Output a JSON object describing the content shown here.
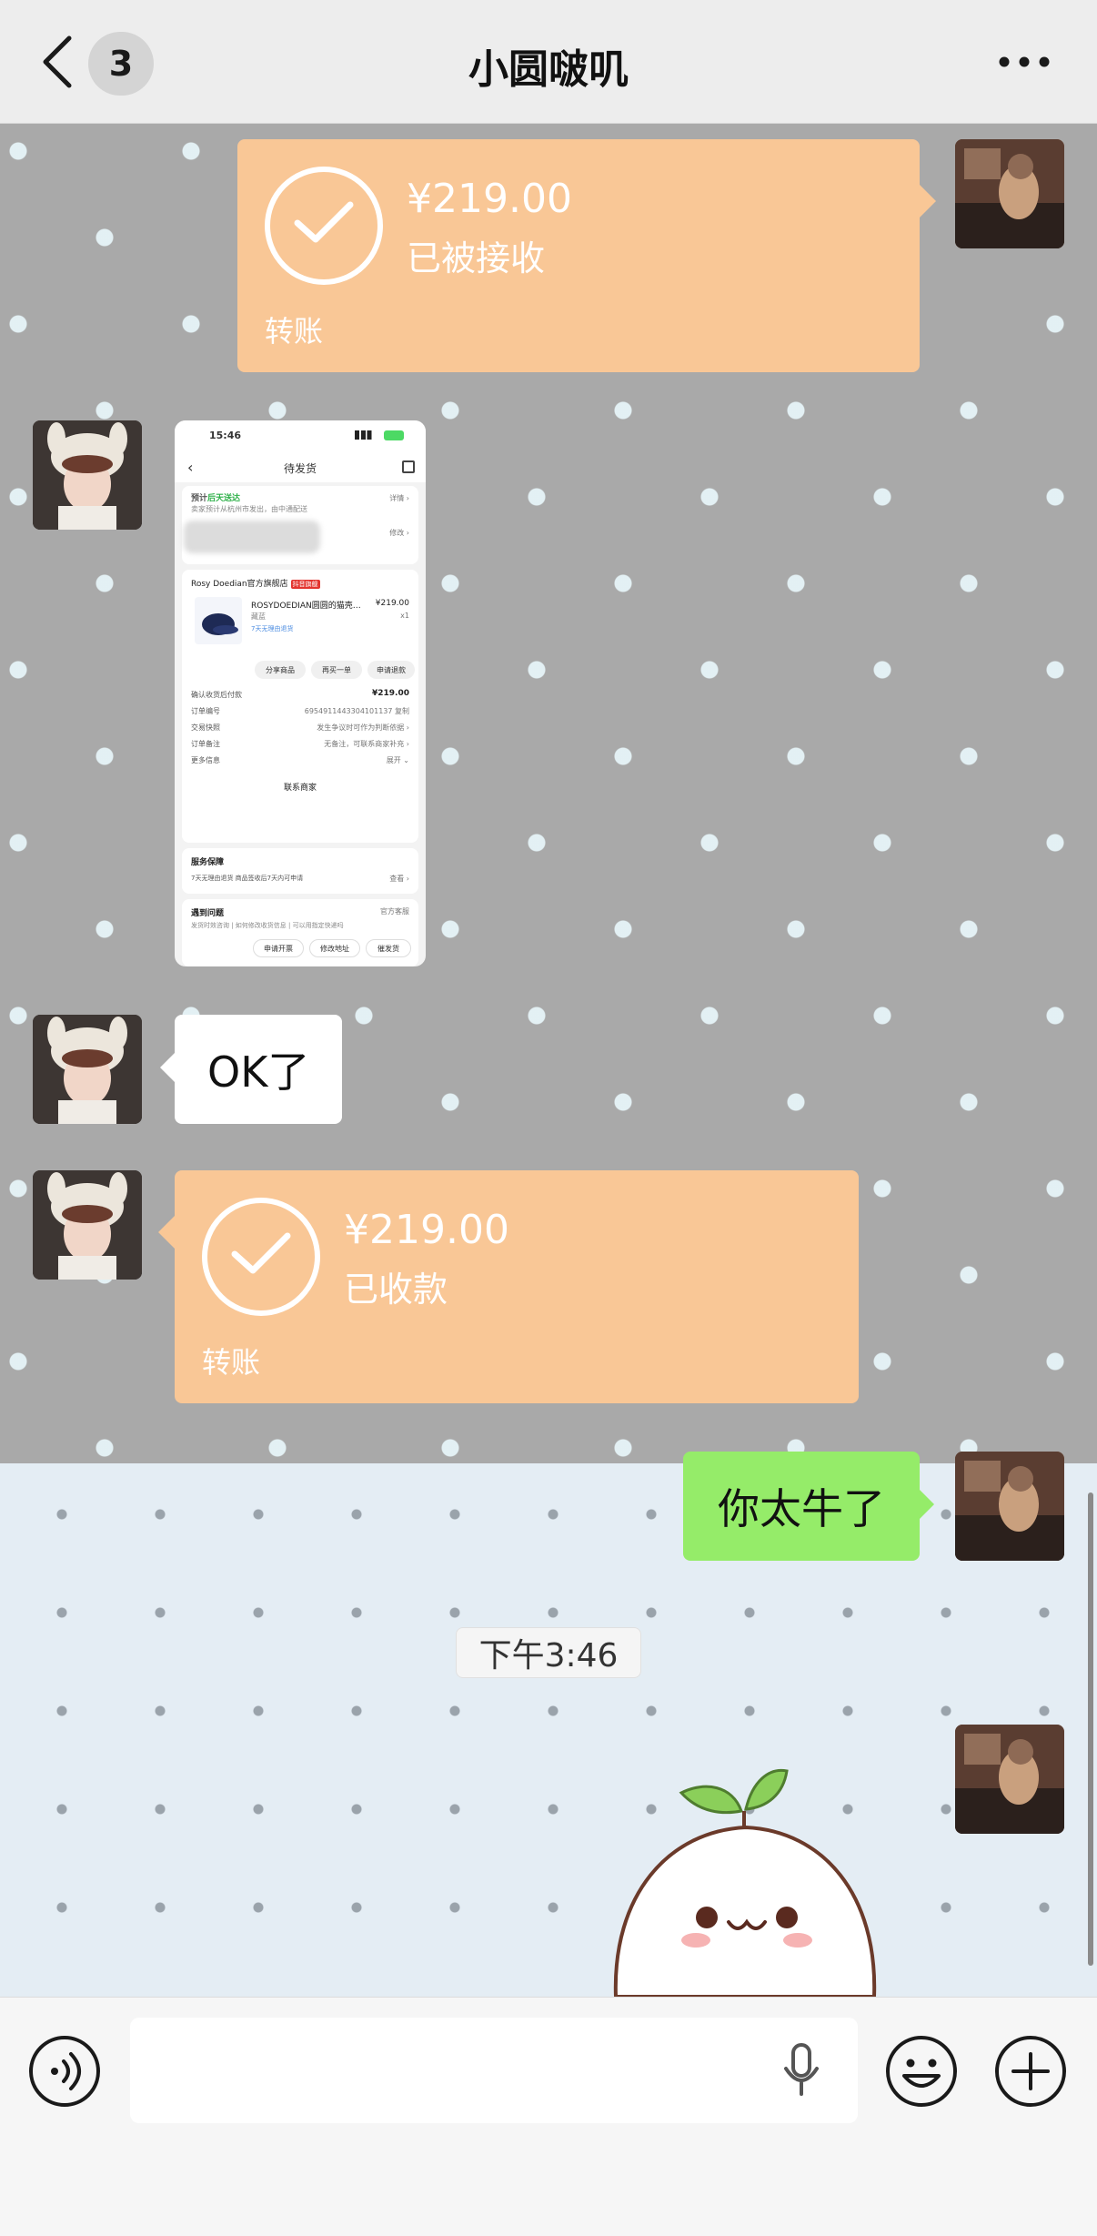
{
  "header": {
    "back_icon": "chevron-left-icon",
    "unread_count": "3",
    "title": "小圆啵叽",
    "more_icon": "more-dots-icon"
  },
  "messages": {
    "transfer_sent": {
      "amount": "¥219.00",
      "status": "已被接收",
      "label": "转账"
    },
    "screenshot": {
      "time": "15:46",
      "nav_title": "待发货",
      "eta_prefix": "预计",
      "eta_highlight": "后天送达",
      "eta_sub": "卖家预计从杭州市发出，由中通配送",
      "detail_link": "详情 ›",
      "modify_link": "修改 ›",
      "shop_name": "Rosy Doedian官方旗舰店",
      "shop_tag": "抖音旗舰",
      "product_name": "ROSYDOEDIAN圆圆的猫壳…",
      "product_color": "藏蓝",
      "product_service": "7天无理由退货",
      "product_price": "¥219.00",
      "product_qty": "x1",
      "btn_share": "分享商品",
      "btn_rebuy": "再买一单",
      "btn_refund": "申请退款",
      "paid_label": "确认收货后付款",
      "paid_value": "¥219.00",
      "order_label": "订单编号",
      "order_value": "6954911443304101137  复制",
      "trade_label": "交易快照",
      "trade_value": "发生争议时可作为判断依据 ›",
      "remark_label": "订单备注",
      "remark_value": "无备注，可联系商家补充 ›",
      "more_label": "更多信息",
      "more_value": "展开 ⌄",
      "contact": "联系商家",
      "service_title": "服务保障",
      "service_line": "7天无理由退货  商品签收后7天内可申请",
      "service_link": "查看 ›",
      "issue_title": "遇到问题",
      "issue_link": "官方客服",
      "issue_items": "发货时效咨询 | 如何修改收货信息 | 可以用指定快递吗",
      "btn_invoice": "申请开票",
      "btn_address": "修改地址",
      "btn_urge": "催发货"
    },
    "text_ok": "OK了",
    "transfer_received": {
      "amount": "¥219.00",
      "status": "已收款",
      "label": "转账"
    },
    "text_reply": "你太牛了",
    "timestamp": "下午3:46"
  },
  "input_bar": {
    "voice_icon": "voice-icon",
    "mic_icon": "mic-icon",
    "emoji_icon": "emoji-icon",
    "plus_icon": "plus-icon"
  },
  "colors": {
    "transfer": "#f9c796",
    "green_bubble": "#95ec69",
    "header_bg": "#ededed"
  }
}
